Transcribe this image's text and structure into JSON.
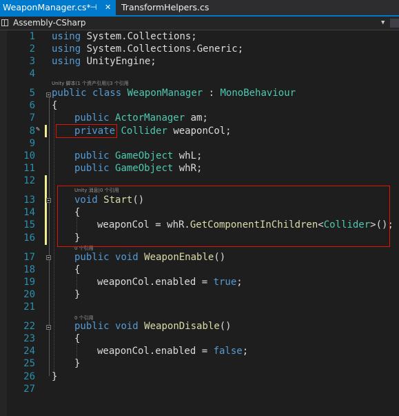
{
  "tabs": [
    {
      "label": "WeaponManager.cs*",
      "active": true,
      "pin_icon": "pin-icon",
      "close_icon": "close-icon"
    },
    {
      "label": "TransformHelpers.cs",
      "active": false
    }
  ],
  "navbar": {
    "project": "Assembly-CSharp",
    "project_icon": "project-icon",
    "dropdown_icon": "chevron-down-icon"
  },
  "codelens": {
    "class": "Unity 脚本(1 个资产引用)|3 个引用",
    "start": "Unity 消息|0 个引用",
    "weapon_enable": "0 个引用",
    "weapon_disable": "0 个引用"
  },
  "colors": {
    "accent": "#007acc",
    "keyword": "#569cd6",
    "type": "#4ec9b0",
    "method": "#dcdcaa",
    "line_number": "#2b91af",
    "highlight_box": "#e51400",
    "change_bar": "#efef91"
  },
  "lines": [
    {
      "n": "1",
      "tokens": [
        {
          "t": "using",
          "c": "kw"
        },
        {
          "t": " System.Collections;",
          "c": "id"
        }
      ]
    },
    {
      "n": "2",
      "tokens": [
        {
          "t": "using",
          "c": "kw"
        },
        {
          "t": " System.Collections.Generic;",
          "c": "id"
        }
      ]
    },
    {
      "n": "3",
      "tokens": [
        {
          "t": "using",
          "c": "kw"
        },
        {
          "t": " UnityEngine;",
          "c": "id"
        }
      ]
    },
    {
      "n": "4",
      "tokens": []
    },
    {
      "n": "5",
      "tokens": [
        {
          "t": "public",
          "c": "kw"
        },
        {
          "t": " ",
          "c": "id"
        },
        {
          "t": "class",
          "c": "kw"
        },
        {
          "t": " ",
          "c": "id"
        },
        {
          "t": "WeaponManager",
          "c": "ty"
        },
        {
          "t": " : ",
          "c": "id"
        },
        {
          "t": "MonoBehaviour",
          "c": "ty"
        }
      ]
    },
    {
      "n": "6",
      "tokens": [
        {
          "t": "{",
          "c": "id"
        }
      ]
    },
    {
      "n": "7",
      "tokens": [
        {
          "t": "public",
          "c": "kw"
        },
        {
          "t": " ",
          "c": "id"
        },
        {
          "t": "ActorManager",
          "c": "ty"
        },
        {
          "t": " am;",
          "c": "id"
        }
      ]
    },
    {
      "n": "8",
      "tokens": [
        {
          "t": "private",
          "c": "kw"
        },
        {
          "t": " ",
          "c": "id"
        },
        {
          "t": "Collider",
          "c": "ty"
        },
        {
          "t": " weaponCol;",
          "c": "id"
        }
      ]
    },
    {
      "n": "9",
      "tokens": []
    },
    {
      "n": "10",
      "tokens": [
        {
          "t": "public",
          "c": "kw"
        },
        {
          "t": " ",
          "c": "id"
        },
        {
          "t": "GameObject",
          "c": "ty"
        },
        {
          "t": " whL;",
          "c": "id"
        }
      ]
    },
    {
      "n": "11",
      "tokens": [
        {
          "t": "public",
          "c": "kw"
        },
        {
          "t": " ",
          "c": "id"
        },
        {
          "t": "GameObject",
          "c": "ty"
        },
        {
          "t": " whR;",
          "c": "id"
        }
      ]
    },
    {
      "n": "12",
      "tokens": []
    },
    {
      "n": "13",
      "tokens": [
        {
          "t": "void",
          "c": "kw"
        },
        {
          "t": " ",
          "c": "id"
        },
        {
          "t": "Start",
          "c": "fn"
        },
        {
          "t": "()",
          "c": "id"
        }
      ]
    },
    {
      "n": "14",
      "tokens": [
        {
          "t": "{",
          "c": "id"
        }
      ]
    },
    {
      "n": "15",
      "tokens": [
        {
          "t": "weaponCol = whR.",
          "c": "id"
        },
        {
          "t": "GetComponentInChildren",
          "c": "fn"
        },
        {
          "t": "<",
          "c": "id"
        },
        {
          "t": "Collider",
          "c": "ty"
        },
        {
          "t": ">();",
          "c": "id"
        }
      ]
    },
    {
      "n": "16",
      "tokens": [
        {
          "t": "}",
          "c": "id"
        }
      ]
    },
    {
      "n": "17",
      "tokens": [
        {
          "t": "public",
          "c": "kw"
        },
        {
          "t": " ",
          "c": "id"
        },
        {
          "t": "void",
          "c": "kw"
        },
        {
          "t": " ",
          "c": "id"
        },
        {
          "t": "WeaponEnable",
          "c": "fn"
        },
        {
          "t": "()",
          "c": "id"
        }
      ]
    },
    {
      "n": "18",
      "tokens": [
        {
          "t": "{",
          "c": "id"
        }
      ]
    },
    {
      "n": "19",
      "tokens": [
        {
          "t": "weaponCol.enabled = ",
          "c": "id"
        },
        {
          "t": "true",
          "c": "kw"
        },
        {
          "t": ";",
          "c": "id"
        }
      ]
    },
    {
      "n": "20",
      "tokens": [
        {
          "t": "}",
          "c": "id"
        }
      ]
    },
    {
      "n": "21",
      "tokens": []
    },
    {
      "n": "22",
      "tokens": [
        {
          "t": "public",
          "c": "kw"
        },
        {
          "t": " ",
          "c": "id"
        },
        {
          "t": "void",
          "c": "kw"
        },
        {
          "t": " ",
          "c": "id"
        },
        {
          "t": "WeaponDisable",
          "c": "fn"
        },
        {
          "t": "()",
          "c": "id"
        }
      ]
    },
    {
      "n": "23",
      "tokens": [
        {
          "t": "{",
          "c": "id"
        }
      ]
    },
    {
      "n": "24",
      "tokens": [
        {
          "t": "weaponCol.enabled = ",
          "c": "id"
        },
        {
          "t": "false",
          "c": "kw"
        },
        {
          "t": ";",
          "c": "id"
        }
      ]
    },
    {
      "n": "25",
      "tokens": [
        {
          "t": "}",
          "c": "id"
        }
      ]
    },
    {
      "n": "26",
      "tokens": [
        {
          "t": "}",
          "c": "id"
        }
      ]
    },
    {
      "n": "27",
      "tokens": []
    }
  ]
}
